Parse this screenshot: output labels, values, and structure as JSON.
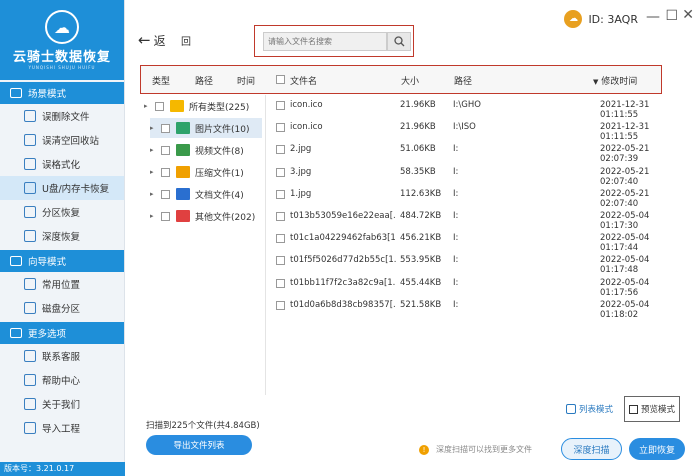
{
  "app": {
    "logo_title": "云骑士数据恢复",
    "logo_sub": "YUNQISHI SHUJU HUIFU",
    "version": "版本号：3.21.0.17",
    "user_id": "ID: 3AQR"
  },
  "sidebar": {
    "sections": [
      {
        "title": "场景模式",
        "items": [
          "误删除文件",
          "误清空回收站",
          "误格式化",
          "U盘/内存卡恢复",
          "分区恢复",
          "深度恢复"
        ]
      },
      {
        "title": "向导模式",
        "items": [
          "常用位置",
          "磁盘分区"
        ]
      },
      {
        "title": "更多选项",
        "items": [
          "联系客服",
          "帮助中心",
          "关于我们",
          "导入工程"
        ]
      }
    ],
    "active_item": "U盘/内存卡恢复"
  },
  "toolbar": {
    "back_label": "返",
    "undo_label": "回",
    "search_placeholder": "请输入文件名搜索"
  },
  "tree_headers": {
    "type": "类型",
    "path": "路径",
    "time": "时间"
  },
  "list_headers": {
    "name": "文件名",
    "size": "大小",
    "path": "路径",
    "modified": "修改时间"
  },
  "tree": [
    {
      "label": "所有类型(225)",
      "icon": "folder-icon",
      "color": "#f5b800"
    },
    {
      "label": "图片文件(10)",
      "icon": "image-icon",
      "color": "#2ea36b"
    },
    {
      "label": "视频文件(8)",
      "icon": "video-icon",
      "color": "#3a9a4a"
    },
    {
      "label": "压缩文件(1)",
      "icon": "archive-icon",
      "color": "#f0a000"
    },
    {
      "label": "文档文件(4)",
      "icon": "document-icon",
      "color": "#2a6fd0"
    },
    {
      "label": "其他文件(202)",
      "icon": "other-files-icon",
      "color": "#e04040"
    }
  ],
  "files": [
    {
      "name": "icon.ico",
      "size": "21.96KB",
      "path": "I:\\GHO",
      "time": "2021-12-31 01:11:55"
    },
    {
      "name": "icon.ico",
      "size": "21.96KB",
      "path": "I:\\ISO",
      "time": "2021-12-31 01:11:55"
    },
    {
      "name": "2.jpg",
      "size": "51.06KB",
      "path": "I:",
      "time": "2022-05-21 02:07:39"
    },
    {
      "name": "3.jpg",
      "size": "58.35KB",
      "path": "I:",
      "time": "2022-05-21 02:07:40"
    },
    {
      "name": "1.jpg",
      "size": "112.63KB",
      "path": "I:",
      "time": "2022-05-21 02:07:40"
    },
    {
      "name": "t013b53059e16e22eaa[...",
      "size": "484.72KB",
      "path": "I:",
      "time": "2022-05-04 01:17:30"
    },
    {
      "name": "t01c1a04229462fab63[1...",
      "size": "456.21KB",
      "path": "I:",
      "time": "2022-05-04 01:17:44"
    },
    {
      "name": "t01f5f5026d77d2b55c[1...",
      "size": "553.95KB",
      "path": "I:",
      "time": "2022-05-04 01:17:48"
    },
    {
      "name": "t01bb11f7f2c3a82c9a[1...",
      "size": "455.44KB",
      "path": "I:",
      "time": "2022-05-04 01:17:56"
    },
    {
      "name": "t01d0a6b8d38cb98357[...",
      "size": "521.58KB",
      "path": "I:",
      "time": "2022-05-04 01:18:02"
    }
  ],
  "view": {
    "list_mode": "列表模式",
    "preview_mode": "预览模式"
  },
  "footer": {
    "scan_info": "扫描到225个文件(共4.84GB)",
    "export": "导出文件列表",
    "tip": "深度扫描可以找到更多文件",
    "deep_scan": "深度扫描",
    "recover": "立即恢复"
  },
  "colors": {
    "accent": "#1e8fd8",
    "button": "#2a8de0",
    "highlight_border": "#c0392b"
  }
}
